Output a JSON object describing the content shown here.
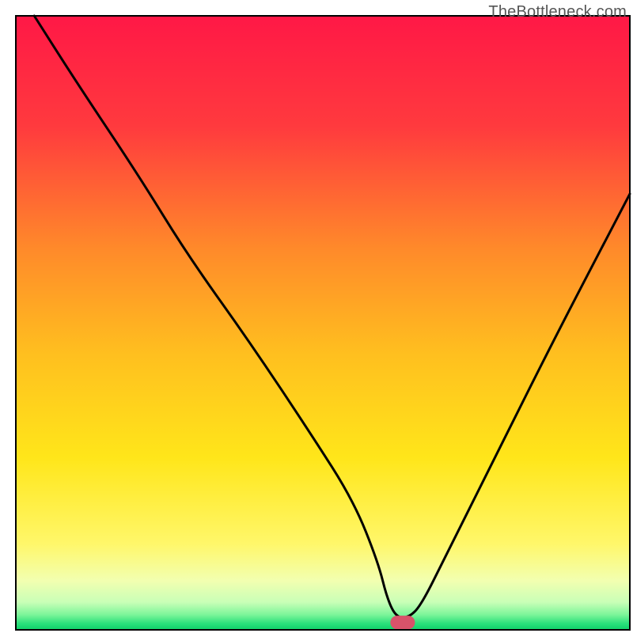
{
  "watermark": "TheBottleneck.com",
  "chart_data": {
    "type": "line",
    "title": "",
    "xlabel": "",
    "ylabel": "",
    "xlim": [
      0,
      100
    ],
    "ylim": [
      0,
      100
    ],
    "grid": false,
    "legend": false,
    "background_gradient_stops": [
      {
        "offset": 0.0,
        "color": "#ff1846"
      },
      {
        "offset": 0.18,
        "color": "#ff3a3e"
      },
      {
        "offset": 0.38,
        "color": "#ff8a2a"
      },
      {
        "offset": 0.55,
        "color": "#ffbf1f"
      },
      {
        "offset": 0.72,
        "color": "#ffe61a"
      },
      {
        "offset": 0.86,
        "color": "#fff76a"
      },
      {
        "offset": 0.92,
        "color": "#f2ffb0"
      },
      {
        "offset": 0.955,
        "color": "#c9ffb7"
      },
      {
        "offset": 0.975,
        "color": "#7ef59a"
      },
      {
        "offset": 0.99,
        "color": "#29e07a"
      },
      {
        "offset": 1.0,
        "color": "#0fd06a"
      }
    ],
    "series": [
      {
        "name": "bottleneck-curve",
        "color": "#000000",
        "x": [
          3,
          10,
          20,
          28,
          38,
          48,
          55,
          59,
          60.5,
          62,
          64,
          66,
          70,
          78,
          88,
          100
        ],
        "values": [
          100,
          89,
          74,
          61,
          47,
          32,
          21,
          11,
          5,
          2,
          2,
          4,
          12,
          28,
          48,
          71
        ]
      }
    ],
    "annotations": [
      {
        "name": "optimal-marker",
        "shape": "rounded-rect",
        "x_center": 63,
        "y_center": 1.2,
        "width": 4.0,
        "height": 2.2,
        "color": "#d8536a"
      }
    ],
    "frame": {
      "stroke": "#000000",
      "stroke_width": 2,
      "x": 2.5,
      "y": 2.5,
      "width": 97.0,
      "height": 97.0
    }
  }
}
